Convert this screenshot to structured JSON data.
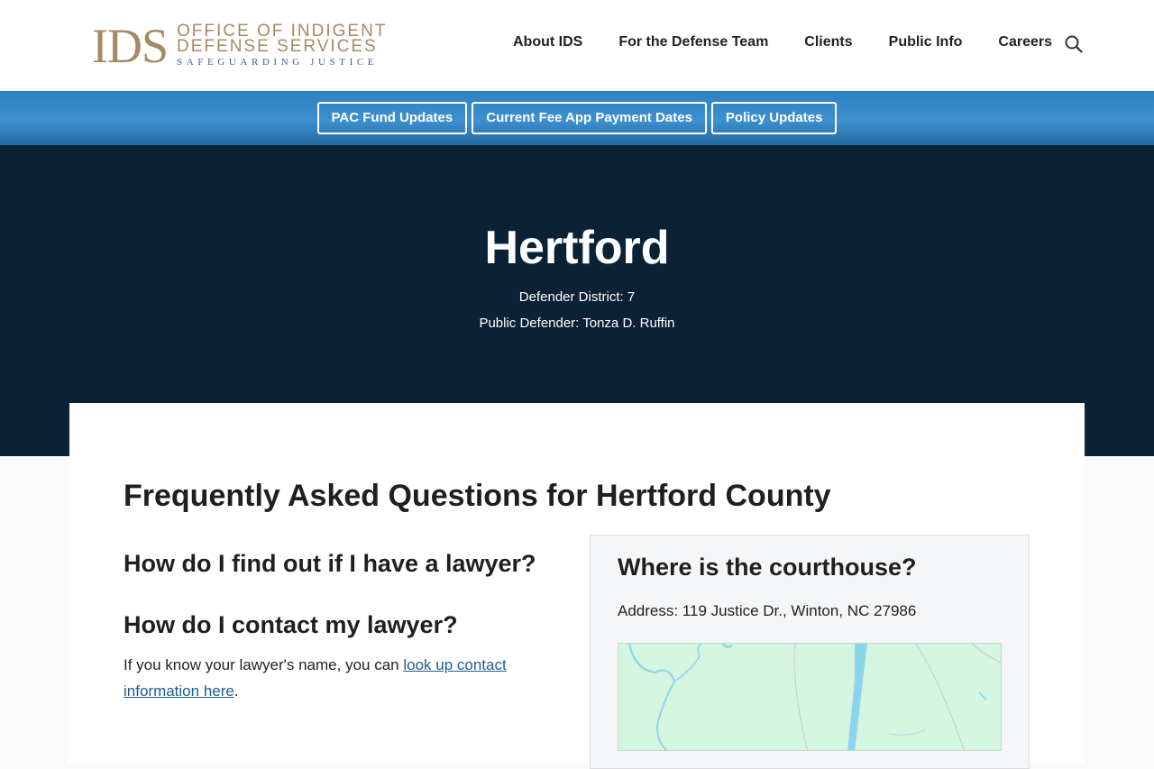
{
  "header": {
    "logo": {
      "mark": "IDS",
      "line1": "OFFICE OF INDIGENT",
      "line2": "DEFENSE SERVICES",
      "tagline": "SAFEGUARDING JUSTICE"
    },
    "nav": [
      "About IDS",
      "For the Defense Team",
      "Clients",
      "Public Info",
      "Careers"
    ],
    "search_icon": "search-icon"
  },
  "utility_bar": {
    "buttons": [
      "PAC Fund Updates",
      "Current Fee App Payment Dates",
      "Policy Updates"
    ]
  },
  "hero": {
    "title": "Hertford",
    "district": "Defender District: 7",
    "public_defender": "Public Defender: Tonza D. Ruffin"
  },
  "main": {
    "faq_title": "Frequently Asked Questions for Hertford County",
    "q1": "How do I find out if I have a lawyer?",
    "q2": "How do I contact my lawyer?",
    "answer_prefix": "If you know your lawyer's name, you can ",
    "answer_link": "look up contact information here",
    "answer_suffix": ".",
    "courthouse": {
      "title": "Where is the courthouse?",
      "address": "Address: 119 Justice Dr., Winton, NC 27986"
    }
  },
  "colors": {
    "accent_gold": "#a48a64",
    "util_blue": "#2f82c2",
    "hero_navy": "#0b2236",
    "link_blue": "#1f5c8f",
    "map_green": "#d4f5e0",
    "map_water": "#8cd3ec"
  }
}
